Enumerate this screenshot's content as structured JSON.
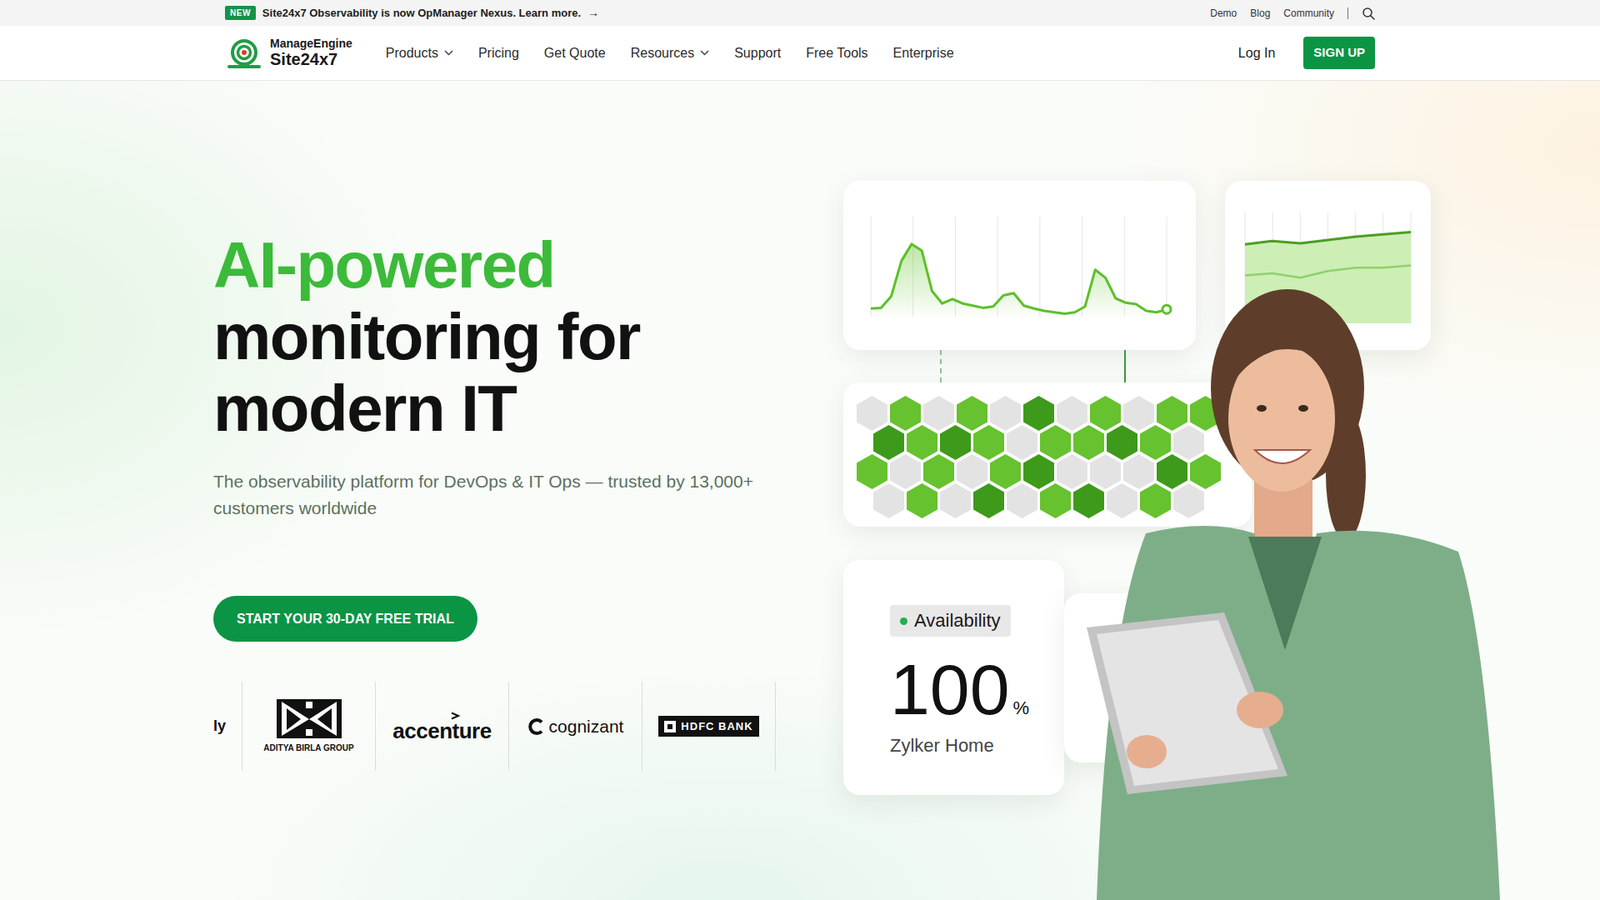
{
  "announcement": {
    "badge": "NEW",
    "text": "Site24x7 Observability is now OpManager Nexus. Learn more.",
    "arrow": "→"
  },
  "utility_links": [
    "Demo",
    "Blog",
    "Community"
  ],
  "brand": {
    "company": "ManageEngine",
    "product": "Site24x7"
  },
  "nav": {
    "items": [
      {
        "label": "Products",
        "has_menu": true
      },
      {
        "label": "Pricing",
        "has_menu": false
      },
      {
        "label": "Get Quote",
        "has_menu": false
      },
      {
        "label": "Resources",
        "has_menu": true
      },
      {
        "label": "Support",
        "has_menu": false
      },
      {
        "label": "Free Tools",
        "has_menu": false
      },
      {
        "label": "Enterprise",
        "has_menu": false
      }
    ],
    "login": "Log In",
    "signup": "SIGN UP"
  },
  "hero": {
    "headline_accent": "AI-powered",
    "headline_rest": [
      "monitoring for",
      "modern IT"
    ],
    "subtitle": "The observability platform for DevOps & IT Ops — trusted by 13,000+ customers worldwide",
    "cta": "START YOUR 30-DAY FREE TRIAL"
  },
  "customer_logos": [
    {
      "name": "ly",
      "kind": "clipped"
    },
    {
      "name": "ADITYA BIRLA GROUP",
      "kind": "emblem"
    },
    {
      "name": "accenture",
      "kind": "wordmark"
    },
    {
      "name": "cognizant",
      "kind": "iconword"
    },
    {
      "name": "HDFC BANK",
      "kind": "boxed"
    }
  ],
  "dashboard": {
    "line_chart": {
      "values": [
        11,
        12,
        28,
        76,
        99,
        90,
        35,
        18,
        24,
        18,
        15,
        12,
        14,
        29,
        32,
        15,
        11,
        8,
        6,
        4,
        6,
        14,
        64,
        53,
        25,
        19,
        17,
        8,
        6,
        10
      ]
    },
    "area_chart": {
      "upper_values": [
        71,
        74,
        72,
        75,
        78,
        80,
        82
      ],
      "lower_values": [
        43,
        45,
        41,
        47,
        50,
        50,
        52
      ]
    },
    "hex_map": {
      "rows": [
        [
          {
            "color": "#e3e3e3"
          },
          {
            "color": "#66c22e"
          },
          {
            "color": "#e3e3e3"
          },
          {
            "color": "#66c22e"
          },
          {
            "color": "#e3e3e3"
          },
          {
            "color": "#3e9a1a"
          },
          {
            "color": "#e3e3e3"
          },
          {
            "color": "#66c22e"
          },
          {
            "color": "#e3e3e3"
          },
          {
            "color": "#66c22e"
          },
          {
            "color": "#66c22e"
          }
        ],
        [
          {
            "color": "#3e9a1a"
          },
          {
            "color": "#66c22e"
          },
          {
            "color": "#3e9a1a"
          },
          {
            "color": "#66c22e"
          },
          {
            "color": "#e3e3e3"
          },
          {
            "color": "#66c22e"
          },
          {
            "color": "#66c22e"
          },
          {
            "color": "#3e9a1a"
          },
          {
            "color": "#66c22e"
          },
          {
            "color": "#e3e3e3"
          }
        ],
        [
          {
            "color": "#66c22e"
          },
          {
            "color": "#e3e3e3"
          },
          {
            "color": "#66c22e"
          },
          {
            "color": "#e3e3e3"
          },
          {
            "color": "#66c22e"
          },
          {
            "color": "#3e9a1a"
          },
          {
            "color": "#e3e3e3"
          },
          {
            "color": "#e3e3e3"
          },
          {
            "color": "#e3e3e3"
          },
          {
            "color": "#3e9a1a"
          },
          {
            "color": "#66c22e"
          }
        ],
        [
          {
            "color": "#e3e3e3"
          },
          {
            "color": "#66c22e"
          },
          {
            "color": "#e3e3e3"
          },
          {
            "color": "#3e9a1a"
          },
          {
            "color": "#e3e3e3"
          },
          {
            "color": "#66c22e"
          },
          {
            "color": "#3e9a1a"
          },
          {
            "color": "#e3e3e3"
          },
          {
            "color": "#66c22e"
          },
          {
            "color": "#e3e3e3"
          }
        ]
      ]
    },
    "availability": {
      "label": "Availability",
      "value": "100",
      "unit": "%",
      "monitor": "Zylker Home"
    }
  }
}
